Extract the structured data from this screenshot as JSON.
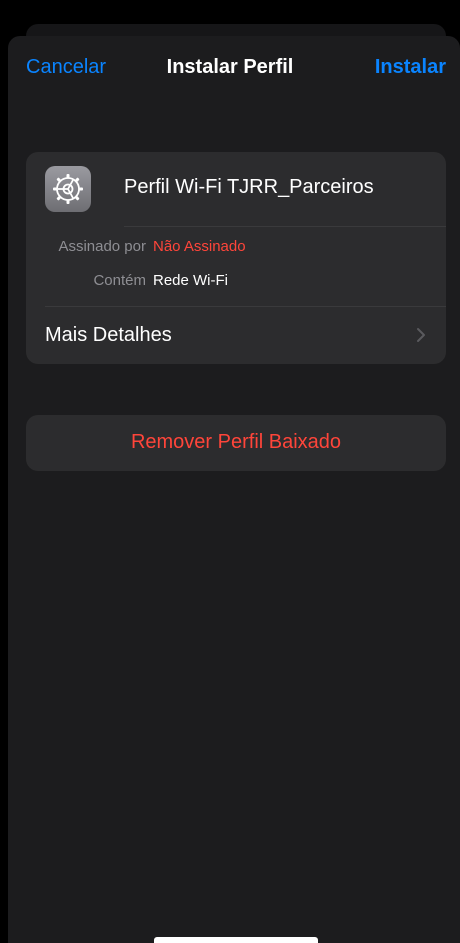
{
  "nav": {
    "cancel_label": "Cancelar",
    "title": "Instalar Perfil",
    "install_label": "Instalar"
  },
  "profile": {
    "icon": "settings-gear-icon",
    "name": "Perfil Wi-Fi TJRR_Parceiros",
    "signed_by_label": "Assinado por",
    "signed_by_value": "Não Assinado",
    "contains_label": "Contém",
    "contains_value": "Rede Wi-Fi",
    "more_details_label": "Mais Detalhes"
  },
  "actions": {
    "remove_label": "Remover Perfil Baixado"
  },
  "colors": {
    "accent_blue": "#0a84ff",
    "destructive_red": "#ff453a",
    "background": "#000000",
    "sheet": "#1c1c1e",
    "card": "#2c2c2e"
  }
}
